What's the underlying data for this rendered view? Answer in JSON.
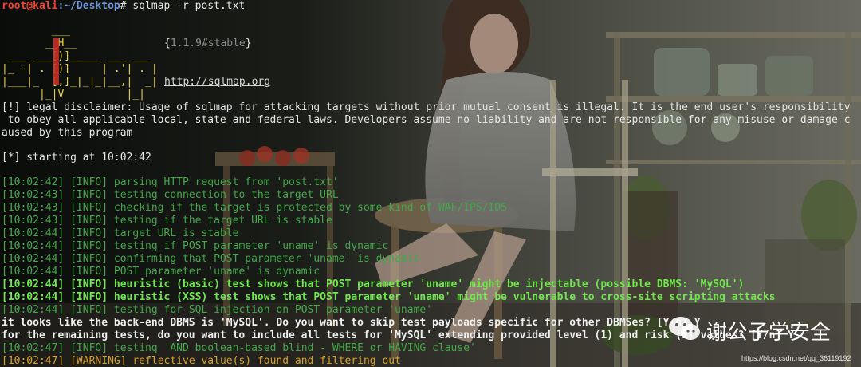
{
  "prompt": {
    "user_host": "root@kali",
    "path": ":~/Desktop",
    "symbol": "#",
    "command": " sqlmap -r post.txt"
  },
  "banner": {
    "art": [
      "        ___",
      "       __H__",
      " ___ ___[)]_____ ___ ___",
      "|_ -| . [)]     | .'| . |",
      "|___|_  [,]_|_|_|__,|  _|",
      "      |_|V          |_|"
    ],
    "version_open": "{",
    "version": "1.1.9#stable",
    "version_close": "}",
    "url": "http://sqlmap.org"
  },
  "disclaimer": [
    "[!] legal disclaimer: Usage of sqlmap for attacking targets without prior mutual consent is illegal. It is the end user's responsibility",
    " to obey all applicable local, state and federal laws. Developers assume no liability and are not responsible for any misuse or damage c",
    "aused by this program"
  ],
  "starting": "[*] starting at 10:02:42",
  "log": [
    {
      "time": "[10:02:42]",
      "level": "[INFO]",
      "text": " parsing HTTP request from 'post.txt'"
    },
    {
      "time": "[10:02:43]",
      "level": "[INFO]",
      "text": " testing connection to the target URL"
    },
    {
      "time": "[10:02:43]",
      "level": "[INFO]",
      "text": " checking if the target is protected by some kind of WAF/IPS/IDS"
    },
    {
      "time": "[10:02:43]",
      "level": "[INFO]",
      "text": " testing if the target URL is stable"
    },
    {
      "time": "[10:02:44]",
      "level": "[INFO]",
      "text": " target URL is stable"
    },
    {
      "time": "[10:02:44]",
      "level": "[INFO]",
      "text": " testing if POST parameter 'uname' is dynamic"
    },
    {
      "time": "[10:02:44]",
      "level": "[INFO]",
      "text": " confirming that POST parameter 'uname' is dynamic"
    },
    {
      "time": "[10:02:44]",
      "level": "[INFO]",
      "text": " POST parameter 'uname' is dynamic"
    },
    {
      "time": "[10:02:44]",
      "level": "[INFO]",
      "text": " heuristic (basic) test shows that POST parameter 'uname' might be injectable (possible DBMS: 'MySQL')"
    },
    {
      "time": "[10:02:44]",
      "level": "[INFO]",
      "text": " heuristic (XSS) test shows that POST parameter 'uname' might be vulnerable to cross-site scripting attacks"
    },
    {
      "time": "[10:02:44]",
      "level": "[INFO]",
      "text": " testing for SQL injection on POST parameter 'uname'"
    }
  ],
  "question": [
    "it looks like the back-end DBMS is 'MySQL'. Do you want to skip test payloads specific for other DBMSes? [Y/n] Y",
    "for the remaining tests, do you want to include all tests for 'MySQL' extending provided level (1) and risk (1) values? [Y/n] Y"
  ],
  "log2": [
    {
      "time": "[10:02:47]",
      "level": "[INFO]",
      "text": " testing 'AND boolean-based blind - WHERE or HAVING clause'"
    },
    {
      "time": "[10:02:47]",
      "level": "[WARNING]",
      "text": " reflective value(s) found and filtering out"
    }
  ],
  "watermark": {
    "brand": "谢公子学安全",
    "url": "https://blog.csdn.net/qq_36119192"
  }
}
